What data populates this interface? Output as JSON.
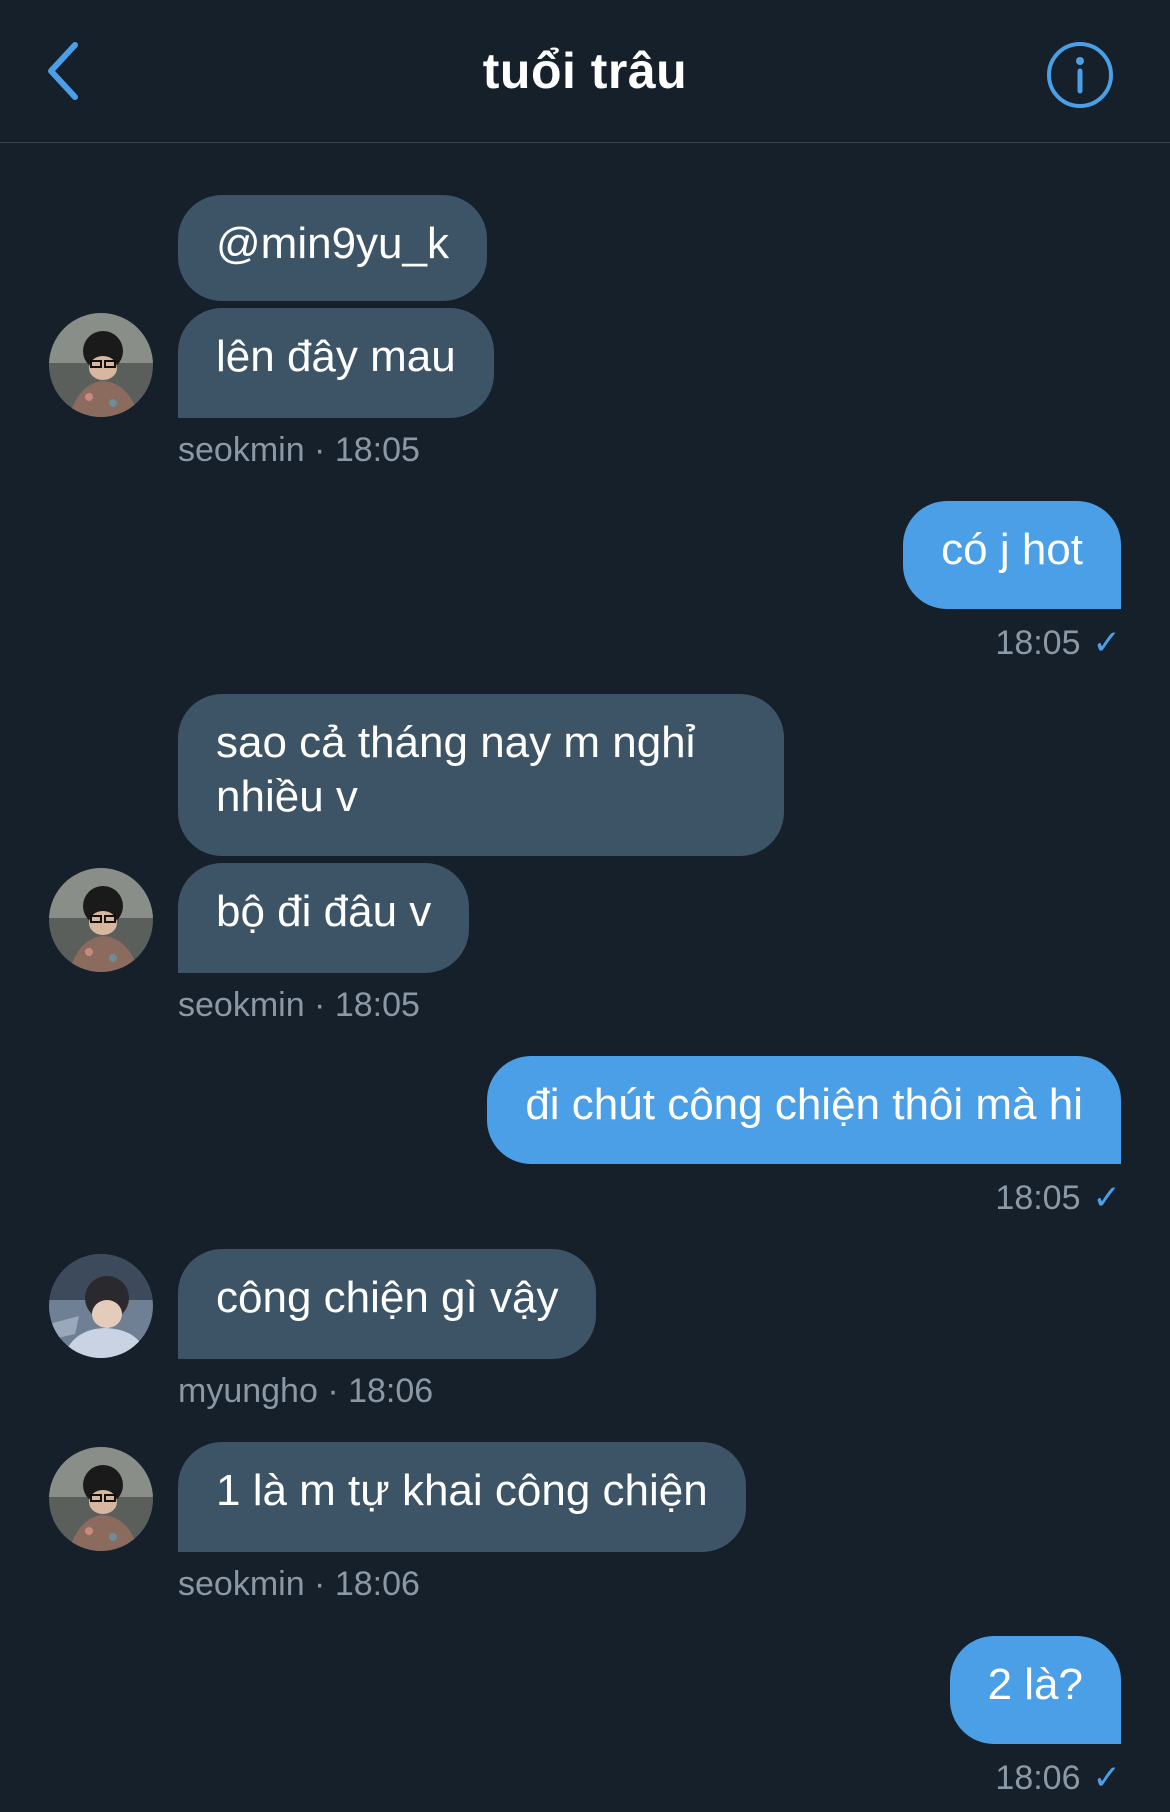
{
  "header": {
    "title": "tuổi trâu",
    "back_icon": "chevron-left-icon",
    "info_icon": "info-icon",
    "accent": "#4b9fe6"
  },
  "messages": [
    {
      "sender": "seokmin",
      "text": "@min9yu_k"
    },
    {
      "sender": "seokmin",
      "text": "lên đây mau",
      "meta": "seokmin · 18:05"
    },
    {
      "sender": "me",
      "text": "có j hot",
      "time": "18:05"
    },
    {
      "sender": "seokmin",
      "text": "sao cả tháng nay m nghỉ nhiều v"
    },
    {
      "sender": "seokmin",
      "text": "bộ đi đâu v",
      "meta": "seokmin · 18:05"
    },
    {
      "sender": "me",
      "text": "đi chút công chiện thôi mà hi",
      "time": "18:05"
    },
    {
      "sender": "myungho",
      "text": "công chiện gì vậy",
      "meta": "myungho · 18:06"
    },
    {
      "sender": "seokmin",
      "text": "1 là m tự khai công chiện",
      "meta": "seokmin · 18:06"
    },
    {
      "sender": "me",
      "text": "2 là?",
      "time": "18:06"
    }
  ],
  "read_check": "✓"
}
